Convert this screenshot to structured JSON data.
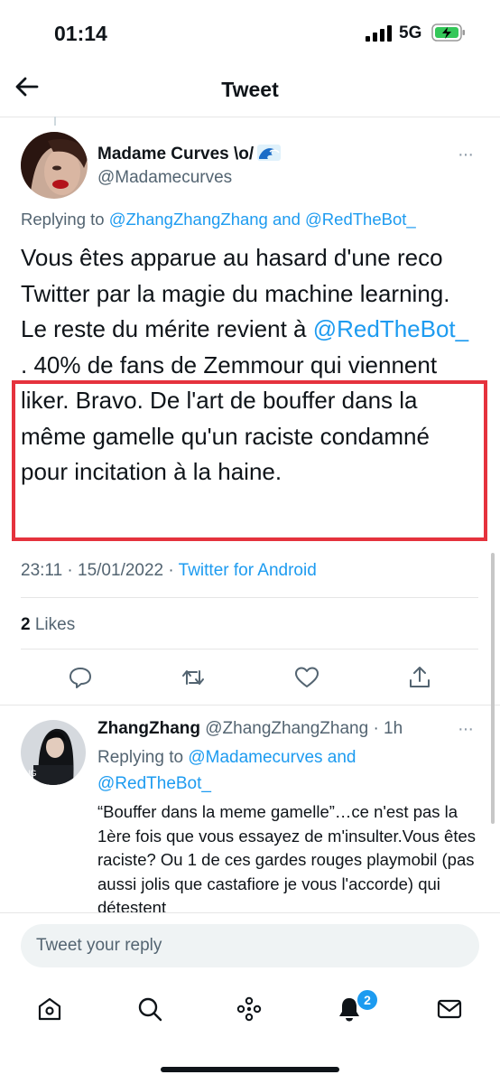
{
  "status_bar": {
    "time": "01:14",
    "network": "5G"
  },
  "header": {
    "title": "Tweet"
  },
  "main_tweet": {
    "name": "Madame Curves \\o/",
    "handle": "@Madamecurves",
    "more": "···",
    "replying_prefix": "Replying to",
    "replying_user1": "@ZhangZhangZhang",
    "replying_and": "and",
    "replying_user2": "@RedTheBot_",
    "text_part1": "Vous êtes apparue au hasard d'une reco Twitter par la magie du machine learning. Le reste du mérite revient à ",
    "text_mention": "@RedTheBot_",
    "text_part2": " . 40% de fans de Zemmour qui viennent liker. Bravo. De l'art de bouffer dans la même gamelle qu'un raciste condamné pour incitation à la haine.",
    "timestamp": "23:11 · 15/01/2022 · ",
    "source": "Twitter for Android",
    "likes_count": "2",
    "likes_label": "Likes",
    "highlight_color": "#e5323d"
  },
  "reply_tweet": {
    "name": "ZhangZhang",
    "handle_time": "@ZhangZhangZhang · 1h",
    "more": "···",
    "replying_prefix": "Replying to",
    "replying_user1": "@Madamecurves",
    "replying_and": "and",
    "replying_user2": "@RedTheBot_",
    "text": "“Bouffer dans la meme gamelle”…ce n'est pas la 1ère fois que vous essayez de m'insulter.Vous êtes raciste? Ou 1 de ces gardes rouges playmobil (pas aussi jolis que castafiore je vous l'accorde) qui détestent"
  },
  "composer": {
    "placeholder": "Tweet your reply"
  },
  "tab_bar": {
    "notifications_badge": "2"
  },
  "colors": {
    "accent": "#1d9bf0",
    "text": "#0f1419",
    "secondary": "#536471"
  }
}
